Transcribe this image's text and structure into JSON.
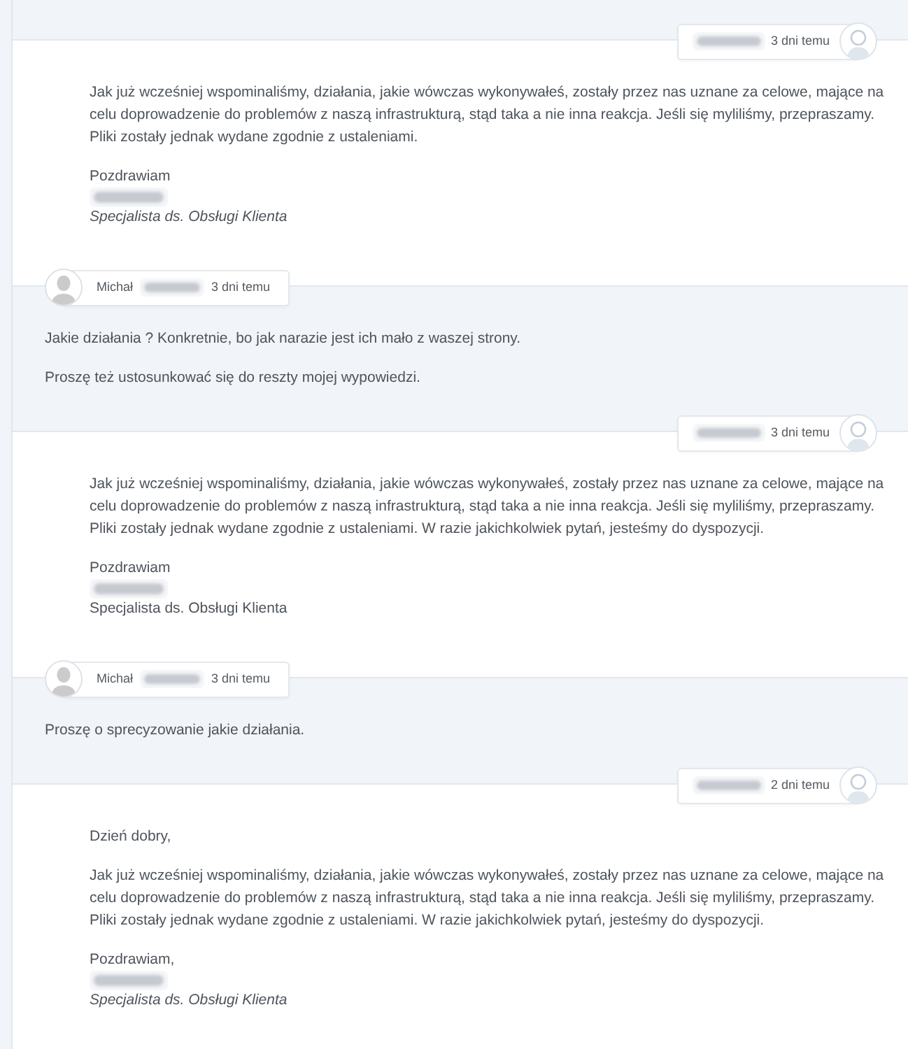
{
  "messages": [
    {
      "kind": "staff",
      "author": {
        "blurred": true
      },
      "time": "3 dni temu",
      "paragraphs": [
        "Jak już wcześniej wspominaliśmy, działania, jakie wówczas wykonywałeś, zostały przez nas uznane za celowe, mające na celu doprowadzenie do problemów z naszą infrastrukturą, stąd taka a nie inna reakcja. Jeśli się myliliśmy, przepraszamy. Pliki zostały jednak wydane zgodnie z ustaleniami."
      ],
      "signature": {
        "greeting": "Pozdrawiam",
        "name_blurred": true,
        "role": "Specjalista ds. Obsługi Klienta",
        "role_italic": true
      }
    },
    {
      "kind": "customer",
      "author": {
        "name": "Michał",
        "blurred": true
      },
      "time": "3 dni temu",
      "paragraphs": [
        "Jakie działania ? Konkretnie, bo jak narazie jest ich mało z waszej strony.",
        "Proszę też ustosunkować się do reszty mojej wypowiedzi."
      ]
    },
    {
      "kind": "staff",
      "author": {
        "blurred": true
      },
      "time": "3 dni temu",
      "paragraphs": [
        "Jak już wcześniej wspominaliśmy, działania, jakie wówczas wykonywałeś, zostały przez nas uznane za celowe, mające na celu doprowadzenie do problemów z naszą infrastrukturą, stąd taka a nie inna reakcja. Jeśli się myliliśmy, przepraszamy. Pliki zostały jednak wydane zgodnie z ustaleniami. W razie jakichkolwiek pytań, jesteśmy do dyspozycji."
      ],
      "signature": {
        "greeting": "Pozdrawiam",
        "name_blurred": true,
        "role": "Specjalista ds. Obsługi Klienta",
        "role_italic": false
      }
    },
    {
      "kind": "customer",
      "author": {
        "name": "Michał",
        "blurred": true
      },
      "time": "3 dni temu",
      "paragraphs": [
        "Proszę o sprecyzowanie jakie działania."
      ]
    },
    {
      "kind": "staff",
      "author": {
        "blurred": true
      },
      "time": "2 dni temu",
      "paragraphs": [
        "Dzień dobry,",
        "Jak już wcześniej wspominaliśmy, działania, jakie wówczas wykonywałeś, zostały przez nas uznane za celowe, mające na celu doprowadzenie do problemów z naszą infrastrukturą, stąd taka a nie inna reakcja. Jeśli się myliliśmy, przepraszamy. Pliki zostały jednak wydane zgodnie z ustaleniami. W razie jakichkolwiek pytań, jesteśmy do dyspozycji."
      ],
      "signature": {
        "greeting": "Pozdrawiam,",
        "name_blurred": true,
        "role": "Specjalista ds. Obsługi Klienta",
        "role_italic": true
      }
    }
  ]
}
